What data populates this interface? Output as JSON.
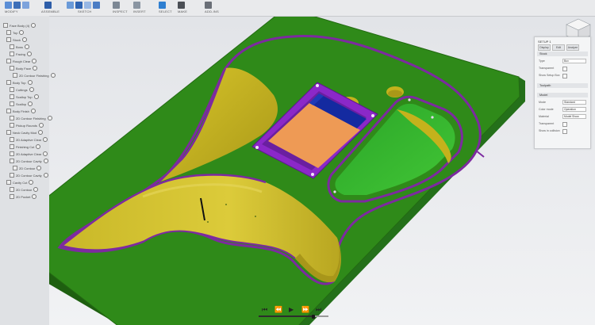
{
  "app": {
    "toolbar_groups": [
      {
        "label": "MODIFY",
        "icons": [
          "push-pull-icon",
          "fillet-icon",
          "shell-icon"
        ]
      },
      {
        "label": "ASSEMBLE",
        "icons": [
          "joint-icon"
        ]
      },
      {
        "label": "SKETCH",
        "icons": [
          "sketch-icon",
          "extrude-icon",
          "revolve-icon",
          "sweep-icon"
        ]
      },
      {
        "label": "INSPECT",
        "icons": [
          "measure-icon"
        ]
      },
      {
        "label": "INSERT",
        "icons": [
          "insert-icon"
        ]
      },
      {
        "label": "SELECT",
        "icons": [
          "select-icon"
        ]
      },
      {
        "label": "MAKE",
        "icons": [
          "make-icon"
        ]
      },
      {
        "label": "ADD-INS",
        "icons": [
          "addins-icon"
        ]
      }
    ],
    "accent_color": "#2f7fd1"
  },
  "browser": {
    "items": [
      "Face Body (4)",
      "Top",
      "Stock",
      "Boss",
      "Facing",
      "Rough Clear",
      "Body Face",
      "2D Contour Finishing",
      "Body Top",
      "Cuttings",
      "Scallop Top",
      "Scallop",
      "Body Finish",
      "2D Contour Finishing",
      "Pickup Rounds",
      "Neck Cavity Mod",
      "2D Adaptive Clear",
      "Finishing Cut",
      "2D Adaptive Clear",
      "2D Contour Cavity",
      "2D Contour",
      "2D Contour Cavity",
      "Cavity Cut",
      "2D Contour",
      "2D Pocket"
    ]
  },
  "panel": {
    "title": "SETUP 1",
    "tabs": [
      "Display",
      "Edit",
      "Analyze"
    ],
    "section1": "Stock",
    "rows1": [
      {
        "label": "Type",
        "value": "Box"
      },
      {
        "label": "Transparent",
        "value": ""
      },
      {
        "label": "Show Setup Box",
        "value": ""
      }
    ],
    "section2": "Toolpath",
    "section3": "Model",
    "rows3": [
      {
        "label": "Mode",
        "value": "Standard"
      },
      {
        "label": "Color mode",
        "value": "Operation"
      },
      {
        "label": "Material",
        "value": "Model Show"
      },
      {
        "label": "Transparent",
        "value": ""
      },
      {
        "label": "Show in collision",
        "value": ""
      }
    ]
  },
  "colors": {
    "stock_top": "#2f8a19",
    "stock_side": "#1f6511",
    "cavity_wall": "#c4b21c",
    "cavity_floor": "#ccb928",
    "contour_line": "#7d2aa0",
    "pickup_rim": "#8b28c8",
    "pickup_floor": "#ee9a55",
    "pickup_blue": "#142aa0",
    "pocket_green": "#31b52a"
  },
  "playback": {
    "controls": [
      "skip-start-icon",
      "step-back-icon",
      "play-icon",
      "step-forward-icon",
      "skip-end-icon"
    ],
    "progress": 0.78
  }
}
